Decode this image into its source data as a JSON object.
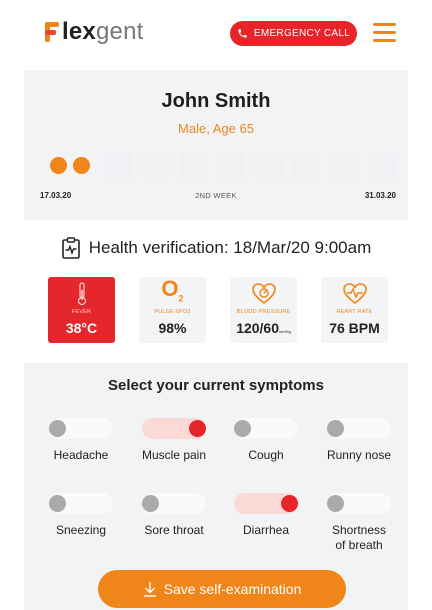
{
  "header": {
    "logo_bold": "lex",
    "logo_light": "gent",
    "emergency_label": "EMERGENCY CALL"
  },
  "patient": {
    "name": "John Smith",
    "subtitle": "Male, Age 65",
    "start_date": "17.03.20",
    "week_label": "2ND WEEK",
    "end_date": "31.03.20"
  },
  "verification": {
    "text": "Health verification: 18/Mar/20 9:00am"
  },
  "vitals": [
    {
      "label": "FEVER",
      "value": "38°C",
      "icon": "thermometer-icon",
      "alert": true
    },
    {
      "label": "PULSE SPO2",
      "value": "98%",
      "icon": "o2-icon",
      "alert": false
    },
    {
      "label": "BLOOD PRESSURE",
      "value": "120/60",
      "unit": "mmHg",
      "icon": "blood-pressure-icon",
      "alert": false
    },
    {
      "label": "HEART RATE",
      "value": "76 BPM",
      "icon": "heart-rate-icon",
      "alert": false
    }
  ],
  "o2_symbol": "O",
  "o2_sub": "2",
  "symptoms": {
    "title": "Select your current symptoms",
    "items": [
      {
        "label": "Headache",
        "active": false
      },
      {
        "label": "Muscle pain",
        "active": true
      },
      {
        "label": "Cough",
        "active": false
      },
      {
        "label": "Runny nose",
        "active": false
      },
      {
        "label": "Sneezing",
        "active": false
      },
      {
        "label": "Sore throat",
        "active": false
      },
      {
        "label": "Diarrhea",
        "active": true
      },
      {
        "label": "Shortness of breath",
        "active": false
      }
    ]
  },
  "save_label": "Save self-examination",
  "colors": {
    "accent": "#f08519",
    "alert": "#e4262d",
    "panel": "#f2f3f5"
  }
}
